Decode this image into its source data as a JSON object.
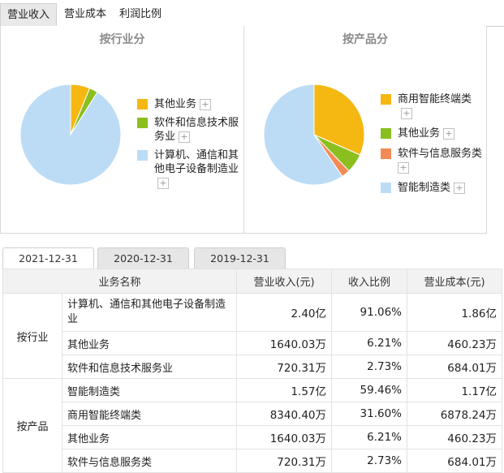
{
  "tabs": [
    "营业收入",
    "营业成本",
    "利润比例"
  ],
  "industry_panel": {
    "title": "按行业分",
    "legend": [
      {
        "label": "其他业务",
        "color": "#f5b812"
      },
      {
        "label": "软件和信息技术服务业",
        "color": "#8bbf1f"
      },
      {
        "label": "计算机、通信和其他电子设备制造业",
        "color": "#bcdcf6"
      }
    ],
    "pie": [
      6.21,
      2.73,
      91.06
    ]
  },
  "product_panel": {
    "title": "按产品分",
    "legend": [
      {
        "label": "商用智能终端类",
        "color": "#f5b812"
      },
      {
        "label": "其他业务",
        "color": "#8bbf1f"
      },
      {
        "label": "软件与信息服务类",
        "color": "#f28b55"
      },
      {
        "label": "智能制造类",
        "color": "#bcdcf6"
      }
    ],
    "pie": [
      31.6,
      6.21,
      2.73,
      59.46
    ]
  },
  "plus_glyph": "+",
  "date_tabs": [
    "2021-12-31",
    "2020-12-31",
    "2019-12-31"
  ],
  "table": {
    "headers": [
      "业务名称",
      "营业收入(元)",
      "收入比例",
      "营业成本(元)"
    ],
    "groups": [
      {
        "name": "按行业",
        "rows": [
          {
            "name": "计算机、通信和其他电子设备制造业",
            "revenue": "2.40亿",
            "ratio": "91.06%",
            "cost": "1.86亿"
          },
          {
            "name": "其他业务",
            "revenue": "1640.03万",
            "ratio": "6.21%",
            "cost": "460.23万"
          },
          {
            "name": "软件和信息技术服务业",
            "revenue": "720.31万",
            "ratio": "2.73%",
            "cost": "684.01万"
          }
        ]
      },
      {
        "name": "按产品",
        "rows": [
          {
            "name": "智能制造类",
            "revenue": "1.57亿",
            "ratio": "59.46%",
            "cost": "1.17亿"
          },
          {
            "name": "商用智能终端类",
            "revenue": "8340.40万",
            "ratio": "31.60%",
            "cost": "6878.24万"
          },
          {
            "name": "其他业务",
            "revenue": "1640.03万",
            "ratio": "6.21%",
            "cost": "460.23万"
          },
          {
            "name": "软件与信息服务类",
            "revenue": "720.31万",
            "ratio": "2.73%",
            "cost": "684.01万"
          }
        ]
      }
    ]
  }
}
